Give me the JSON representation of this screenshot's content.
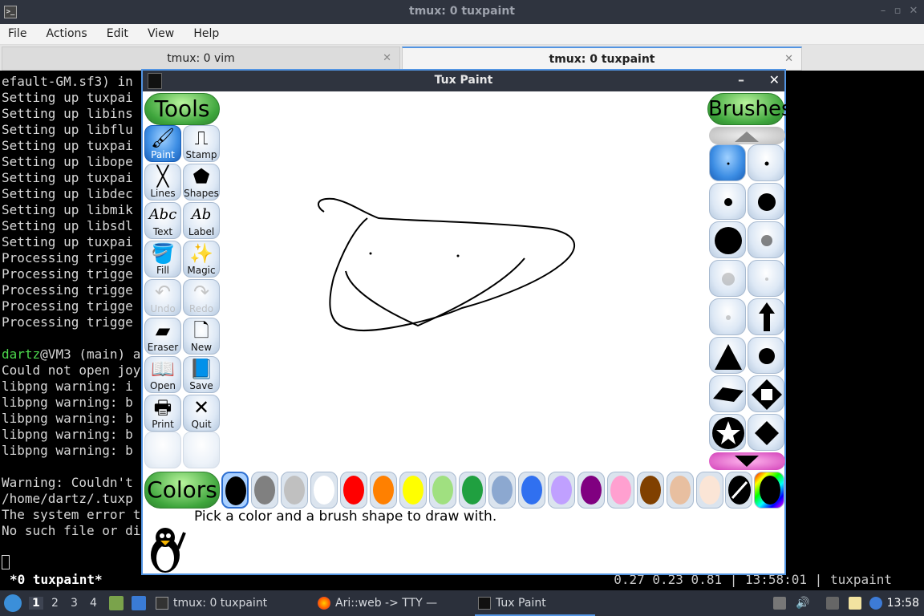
{
  "terminal_window": {
    "title": "tmux: 0 tuxpaint",
    "menu": [
      "File",
      "Actions",
      "Edit",
      "View",
      "Help"
    ],
    "tabs": [
      {
        "label": "tmux: 0 vim",
        "active": false
      },
      {
        "label": "tmux: 0 tuxpaint",
        "active": true
      }
    ],
    "lines": [
      "efault-GM.sf3) in",
      "Setting up tuxpai",
      "Setting up libins",
      "Setting up libflu",
      "Setting up tuxpai",
      "Setting up libope",
      "Setting up tuxpai",
      "Setting up libdec",
      "Setting up libmik",
      "Setting up libsdl",
      "Setting up tuxpai",
      "Processing trigge",
      "Processing trigge",
      "Processing trigge",
      "Processing trigge",
      "Processing trigge",
      "",
      "@VM3 (main) a",
      "Could not open joy",
      "libpng warning: i",
      "libpng warning: b",
      "libpng warning: b",
      "libpng warning: b",
      "libpng warning: b",
      "",
      "Warning: Couldn't",
      "/home/dartz/.tuxp",
      "The system error t",
      "No such file or di"
    ],
    "prompt_user": "dartz",
    "status_window": "*0 tuxpaint*",
    "status_stats": "0.27 0.23 0.81 | 13:58:01 | tuxpaint"
  },
  "tuxpaint": {
    "title": "Tux Paint",
    "tools_header": "Tools",
    "brushes_header": "Brushes",
    "colors_header": "Colors",
    "tools": [
      {
        "label": "Paint",
        "icon": "brush-icon",
        "glyph": "🖌",
        "selected": true
      },
      {
        "label": "Stamp",
        "icon": "stamp-icon",
        "glyph": "⎍",
        "selected": false
      },
      {
        "label": "Lines",
        "icon": "lines-icon",
        "glyph": "╳",
        "selected": false
      },
      {
        "label": "Shapes",
        "icon": "pentagon-icon",
        "glyph": "⬟",
        "selected": false
      },
      {
        "label": "Text",
        "icon": "text-icon",
        "glyph": "Abc",
        "selected": false
      },
      {
        "label": "Label",
        "icon": "label-icon",
        "glyph": "Ab",
        "selected": false
      },
      {
        "label": "Fill",
        "icon": "paint-bucket-icon",
        "glyph": "🪣",
        "selected": false
      },
      {
        "label": "Magic",
        "icon": "magic-wand-icon",
        "glyph": "✨",
        "selected": false
      },
      {
        "label": "Undo",
        "icon": "undo-icon",
        "glyph": "↶",
        "selected": false,
        "disabled": true
      },
      {
        "label": "Redo",
        "icon": "redo-icon",
        "glyph": "↷",
        "selected": false,
        "disabled": true
      },
      {
        "label": "Eraser",
        "icon": "eraser-icon",
        "glyph": "▰",
        "selected": false
      },
      {
        "label": "New",
        "icon": "new-page-icon",
        "glyph": "🗋",
        "selected": false
      },
      {
        "label": "Open",
        "icon": "open-book-icon",
        "glyph": "📖",
        "selected": false
      },
      {
        "label": "Save",
        "icon": "save-book-icon",
        "glyph": "📘",
        "selected": false
      },
      {
        "label": "Print",
        "icon": "printer-icon",
        "glyph": "🖶",
        "selected": false
      },
      {
        "label": "Quit",
        "icon": "quit-x-icon",
        "glyph": "✕",
        "selected": false
      }
    ],
    "colors": [
      "#000000",
      "#808080",
      "#c0c0c0",
      "#ffffff",
      "#ff0000",
      "#ff8000",
      "#ffff00",
      "#a0e080",
      "#20a040",
      "#8ca8d0",
      "#3070f0",
      "#c0a0ff",
      "#800080",
      "#ffa0d0",
      "#804000",
      "#e8bfa0",
      "#fbe5d6"
    ],
    "selected_color_index": 0,
    "tip": "Pick a color and a brush shape to draw with."
  },
  "taskbar": {
    "workspaces": [
      "1",
      "2",
      "3",
      "4"
    ],
    "tasks": [
      {
        "label": "tmux: 0 tuxpaint",
        "icon": "terminal-icon"
      },
      {
        "label": "Ari::web -> TTY — Mo...",
        "icon": "firefox-icon"
      },
      {
        "label": "Tux Paint",
        "icon": "tuxpaint-icon"
      }
    ],
    "clock": "13:58"
  }
}
